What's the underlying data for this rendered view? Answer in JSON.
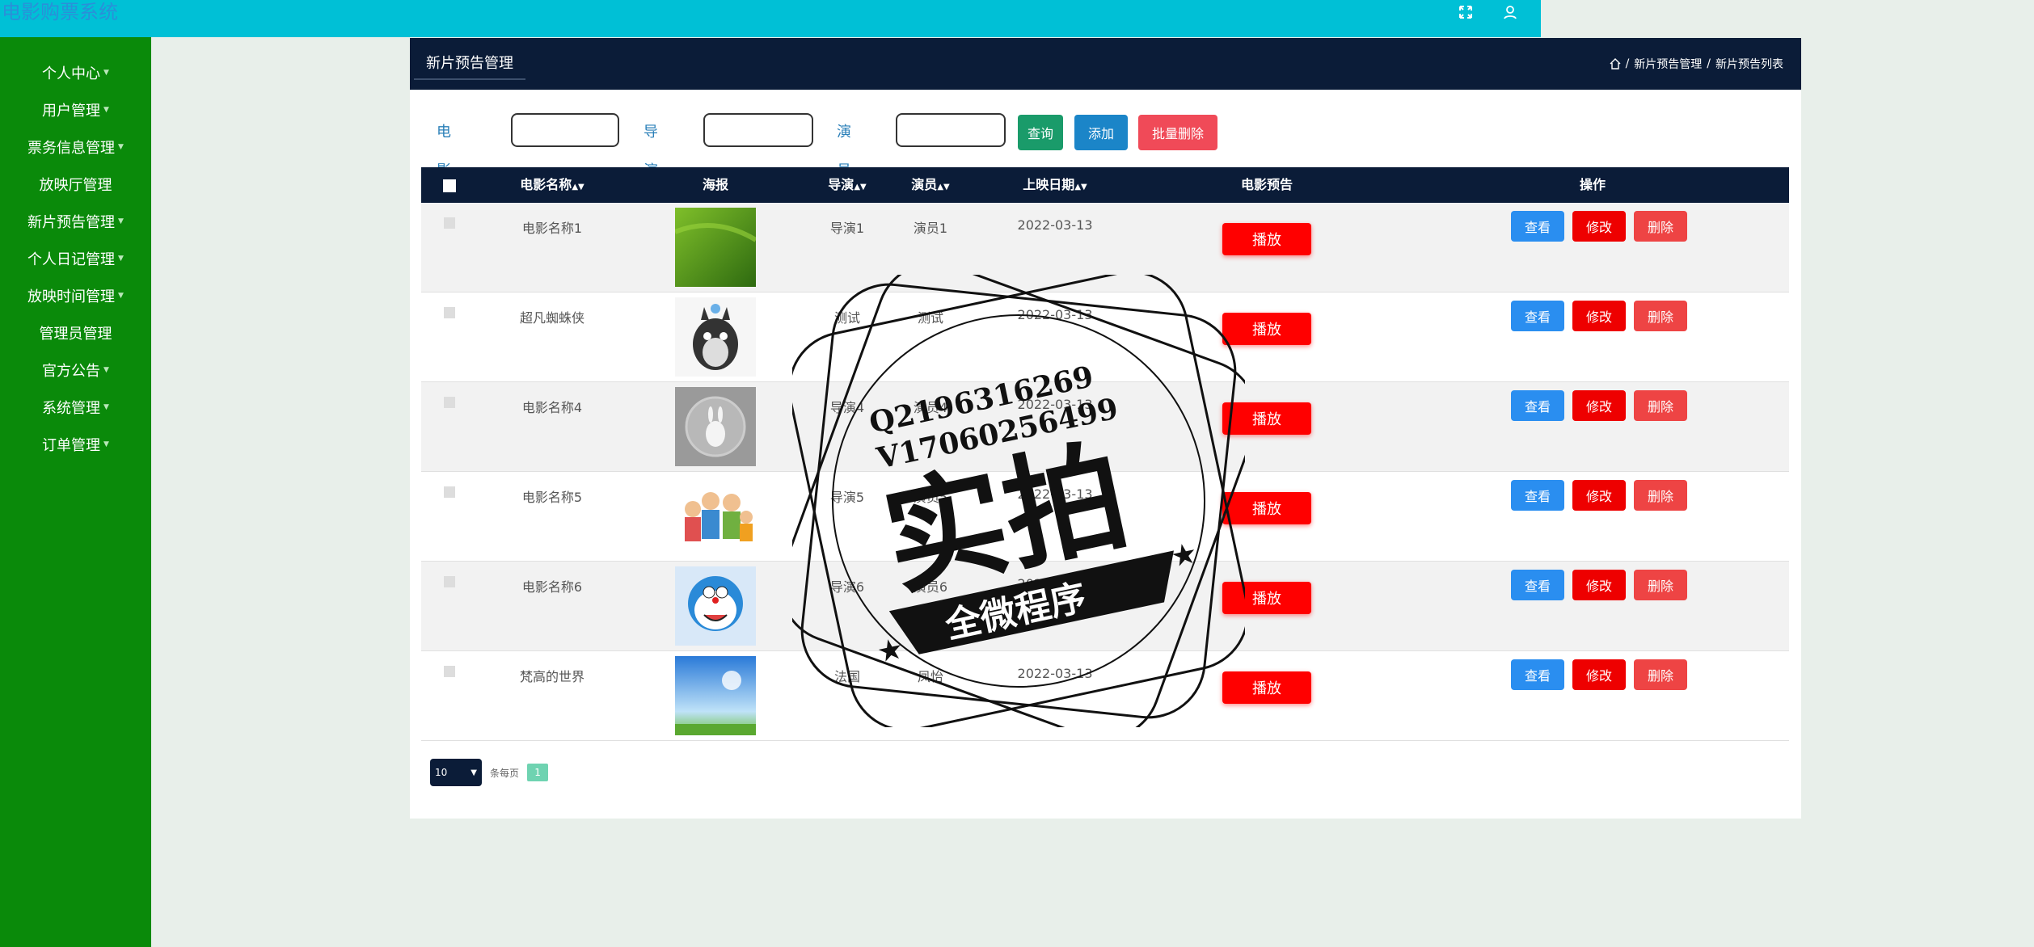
{
  "app": {
    "title": "电影购票系统"
  },
  "sidebar": {
    "items": [
      {
        "label": "个人中心",
        "caret": true
      },
      {
        "label": "用户管理",
        "caret": true
      },
      {
        "label": "票务信息管理",
        "caret": true
      },
      {
        "label": "放映厅管理",
        "caret": false
      },
      {
        "label": "新片预告管理",
        "caret": true
      },
      {
        "label": "个人日记管理",
        "caret": true
      },
      {
        "label": "放映时间管理",
        "caret": true
      },
      {
        "label": "管理员管理",
        "caret": false
      },
      {
        "label": "官方公告",
        "caret": true
      },
      {
        "label": "系统管理",
        "caret": true
      },
      {
        "label": "订单管理",
        "caret": true
      }
    ]
  },
  "panel": {
    "tab": "新片预告管理",
    "breadcrumb": [
      "新片预告管理",
      "新片预告列表"
    ]
  },
  "search": {
    "name_label": "电影名称",
    "director_label": "导演",
    "actor_label": "演员",
    "query_btn": "查询",
    "add_btn": "添加",
    "batch_delete_btn": "批量删除"
  },
  "table": {
    "headers": {
      "name": "电影名称",
      "poster": "海报",
      "director": "导演",
      "actor": "演员",
      "date": "上映日期",
      "trailer": "电影预告",
      "ops": "操作"
    },
    "play_label": "播放",
    "view_label": "查看",
    "edit_label": "修改",
    "delete_label": "删除",
    "rows": [
      {
        "name": "电影名称1",
        "director": "导演1",
        "actor": "演员1",
        "date": "2022-03-13",
        "poster": "green-field"
      },
      {
        "name": "超凡蜘蛛侠",
        "director": "测试",
        "actor": "测试",
        "date": "2022-03-13",
        "poster": "totoro"
      },
      {
        "name": "电影名称4",
        "director": "导演4",
        "actor": "演员4",
        "date": "2022-03-13",
        "poster": "rabbit"
      },
      {
        "name": "电影名称5",
        "director": "导演5",
        "actor": "演员5",
        "date": "2022-03-13",
        "poster": "family"
      },
      {
        "name": "电影名称6",
        "director": "导演6",
        "actor": "演员6",
        "date": "2022-03-13",
        "poster": "doraemon"
      },
      {
        "name": "梵高的世界",
        "director": "法国",
        "actor": "凤怡",
        "date": "2022-03-13",
        "poster": "sky"
      }
    ]
  },
  "pagination": {
    "page_size": "10",
    "per_page_label": "条每页",
    "current_page": "1"
  },
  "watermark": {
    "line1": "Q2196316269",
    "line2": "V17060256499",
    "main": "实拍",
    "banner": "全微程序"
  },
  "colors": {
    "topbar": "#00c0d6",
    "sidebar": "#0a8a0a",
    "header": "#0b1c38",
    "play": "#ff0000",
    "view": "#2a8ef0",
    "edit": "#ee0000",
    "delete": "#ee4444"
  }
}
